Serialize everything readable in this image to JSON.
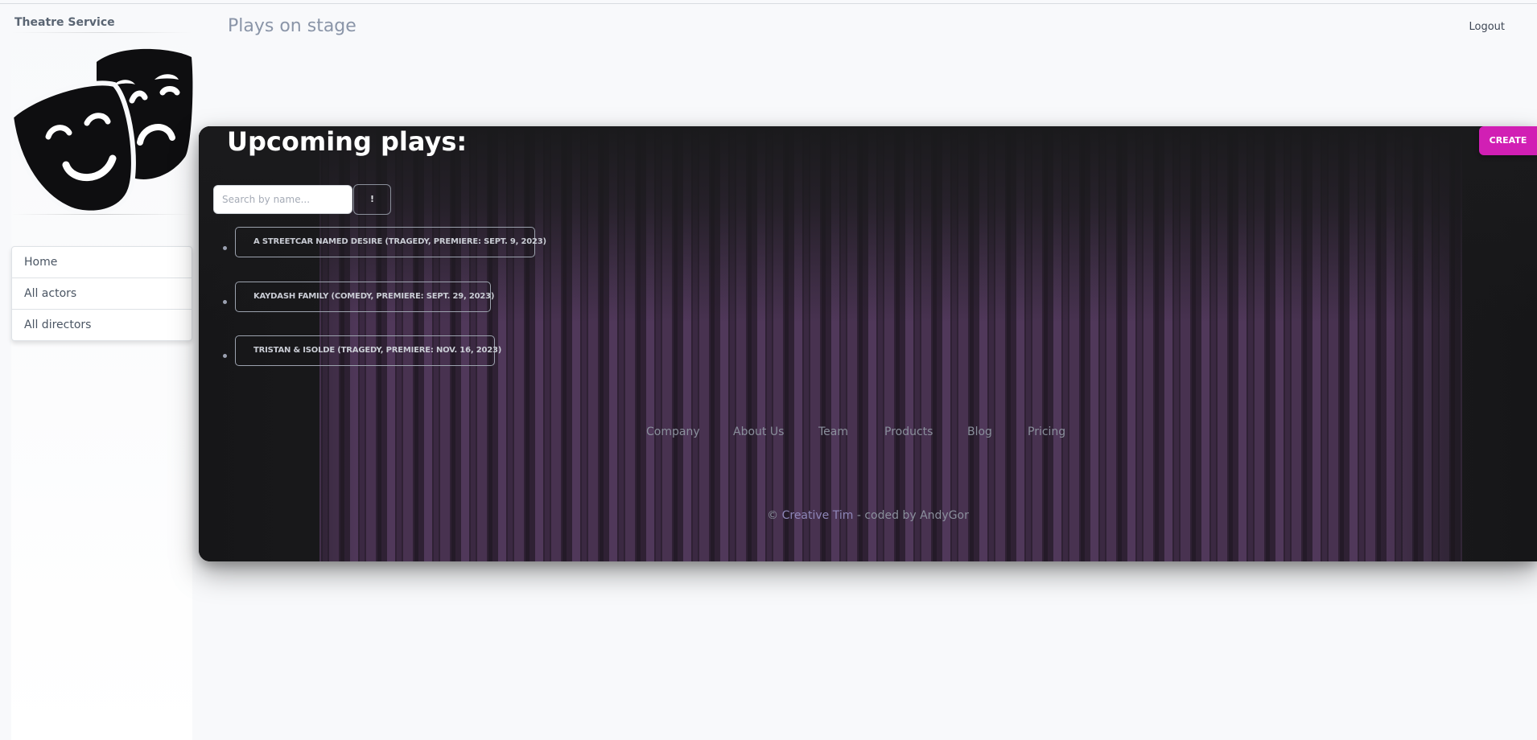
{
  "sidebar": {
    "brand": "Theatre Service",
    "logo_icon": "theatre-masks-icon",
    "items": [
      {
        "label": "Home"
      },
      {
        "label": "All actors"
      },
      {
        "label": "All directors"
      }
    ]
  },
  "header": {
    "title": "Plays on stage",
    "logout_label": "Logout"
  },
  "main": {
    "title": "Upcoming plays:",
    "create_label": "CREATE",
    "search": {
      "placeholder": "Search by name...",
      "value": "",
      "button_label": "!"
    },
    "plays": [
      {
        "label": "A STREETCAR NAMED DESIRE (TRAGEDY, PREMIERE: SEPT. 9, 2023)"
      },
      {
        "label": "KAYDASH FAMILY (COMEDY, PREMIERE: SEPT. 29, 2023)"
      },
      {
        "label": "TRISTAN & ISOLDE (TRAGEDY, PREMIERE: NOV. 16, 2023)"
      }
    ]
  },
  "footer": {
    "links": [
      "Company",
      "About Us",
      "Team",
      "Products",
      "Blog",
      "Pricing"
    ],
    "copyright_prefix": "©",
    "copyright_link": "Creative Tim",
    "copyright_suffix": "- coded by AndyGor"
  },
  "colors": {
    "accent": "#d11fb4",
    "card_background": "#1a1a1c",
    "curtain": "#5b3a66",
    "page_background": "#f8f9fb"
  }
}
